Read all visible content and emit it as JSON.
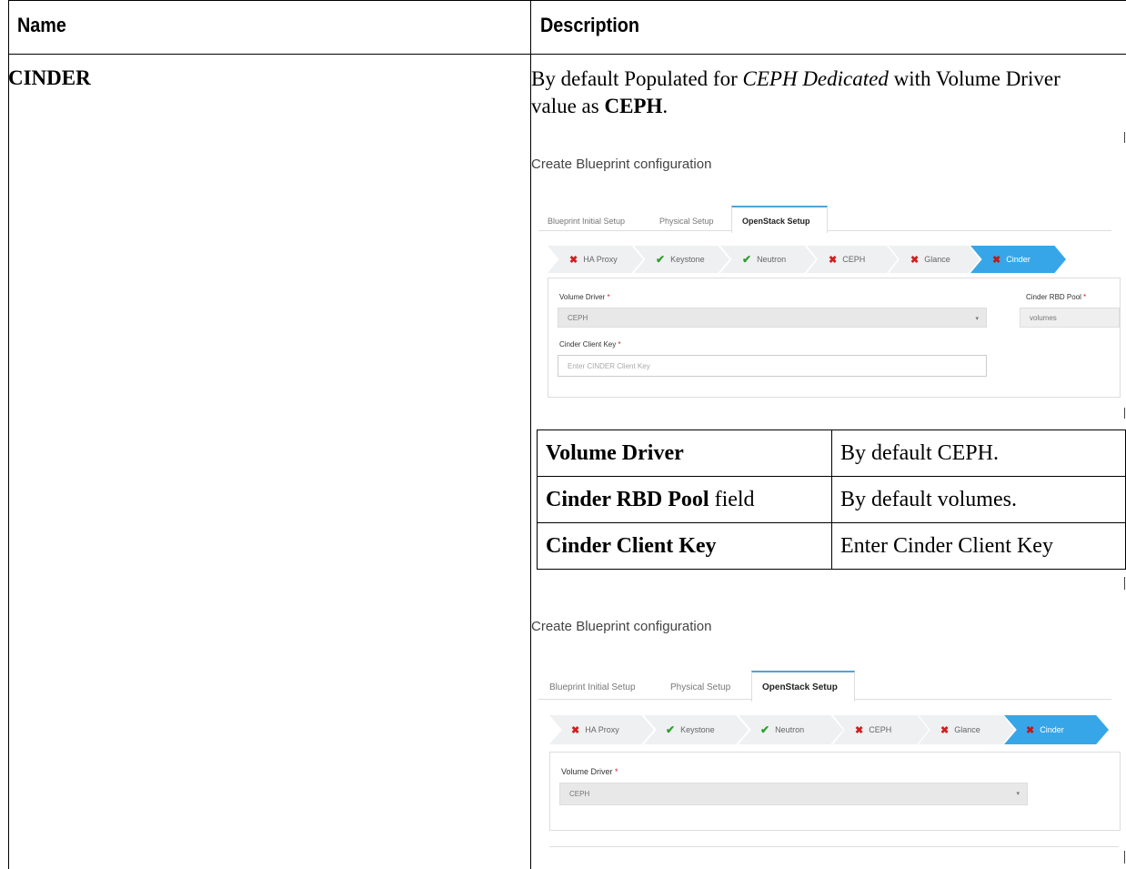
{
  "headers": {
    "name": "Name",
    "description": "Description"
  },
  "row": {
    "name": "CINDER",
    "desc_part1": "By default Populated for ",
    "desc_italic": "CEPH Dedicated",
    "desc_part2": " with Volume Driver value as ",
    "desc_bold": "CEPH",
    "desc_part3": "."
  },
  "screenshot1": {
    "title": "Create Blueprint configuration",
    "tabs": [
      "Blueprint Initial Setup",
      "Physical Setup",
      "OpenStack Setup"
    ],
    "steps": [
      {
        "label": "HA Proxy",
        "status": "error"
      },
      {
        "label": "Keystone",
        "status": "ok"
      },
      {
        "label": "Neutron",
        "status": "ok"
      },
      {
        "label": "CEPH",
        "status": "error"
      },
      {
        "label": "Glance",
        "status": "error"
      },
      {
        "label": "Cinder",
        "status": "error"
      }
    ],
    "volume_driver_label": "Volume Driver",
    "volume_driver_value": "CEPH",
    "rbd_pool_label": "Cinder RBD Pool",
    "rbd_pool_value": "volumes",
    "client_key_label": "Cinder Client Key",
    "client_key_placeholder": "Enter CINDER Client Key",
    "required_mark": "*"
  },
  "field_table": [
    {
      "field_bold": "Volume Driver",
      "field_rest": "",
      "value": "By default CEPH."
    },
    {
      "field_bold": "Cinder RBD Pool",
      "field_rest": " field",
      "value": "By default volumes."
    },
    {
      "field_bold": "Cinder Client Key",
      "field_rest": "",
      "value": "Enter Cinder Client Key"
    }
  ],
  "screenshot2": {
    "title": "Create Blueprint configuration",
    "tabs": [
      "Blueprint Initial Setup",
      "Physical Setup",
      "OpenStack Setup"
    ],
    "steps": [
      {
        "label": "HA Proxy",
        "status": "error"
      },
      {
        "label": "Keystone",
        "status": "ok"
      },
      {
        "label": "Neutron",
        "status": "ok"
      },
      {
        "label": "CEPH",
        "status": "error"
      },
      {
        "label": "Glance",
        "status": "error"
      },
      {
        "label": "Cinder",
        "status": "error"
      }
    ],
    "volume_driver_label": "Volume Driver",
    "volume_driver_value": "CEPH",
    "required_mark": "*"
  },
  "icons": {
    "error": "x-mark-icon",
    "ok": "check-mark-icon",
    "dropdown": "caret-down-icon"
  },
  "colors": {
    "active_step": "#37a6e8",
    "error": "#d02020",
    "ok": "#2e9e2e",
    "active_tab_accent": "#4fa3d9"
  }
}
